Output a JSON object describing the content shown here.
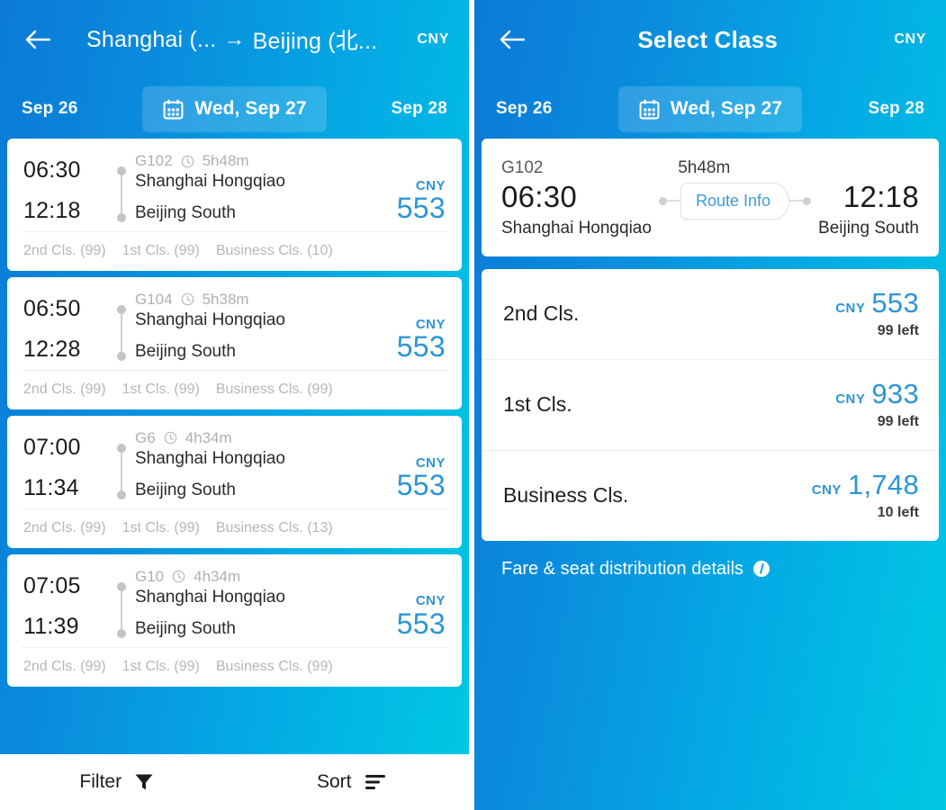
{
  "left": {
    "appbar": {
      "back_icon": "back-arrow-icon",
      "route_from": "Shanghai (...",
      "route_arrow": "→",
      "route_to": "Beijing (北...",
      "currency": "CNY"
    },
    "datestrip": {
      "prev_date": "Sep 26",
      "current_date": "Wed, Sep 27",
      "next_date": "Sep 28",
      "calendar_icon": "calendar-icon"
    },
    "trains": [
      {
        "number": "G102",
        "duration": "5h48m",
        "depart_time": "06:30",
        "arrive_time": "12:18",
        "depart_station": "Shanghai Hongqiao",
        "arrive_station": "Beijing South",
        "currency": "CNY",
        "price": "553",
        "classes": [
          "2nd Cls. (99)",
          "1st Cls. (99)",
          "Business Cls. (10)"
        ]
      },
      {
        "number": "G104",
        "duration": "5h38m",
        "depart_time": "06:50",
        "arrive_time": "12:28",
        "depart_station": "Shanghai Hongqiao",
        "arrive_station": "Beijing South",
        "currency": "CNY",
        "price": "553",
        "classes": [
          "2nd Cls. (99)",
          "1st Cls. (99)",
          "Business Cls. (99)"
        ]
      },
      {
        "number": "G6",
        "duration": "4h34m",
        "depart_time": "07:00",
        "arrive_time": "11:34",
        "depart_station": "Shanghai Hongqiao",
        "arrive_station": "Beijing South",
        "currency": "CNY",
        "price": "553",
        "classes": [
          "2nd Cls. (99)",
          "1st Cls. (99)",
          "Business Cls. (13)"
        ]
      },
      {
        "number": "G10",
        "duration": "4h34m",
        "depart_time": "07:05",
        "arrive_time": "11:39",
        "depart_station": "Shanghai Hongqiao",
        "arrive_station": "Beijing South",
        "currency": "CNY",
        "price": "553",
        "classes": [
          "2nd Cls. (99)",
          "1st Cls. (99)",
          "Business Cls. (99)"
        ]
      }
    ],
    "bottombar": {
      "filter_label": "Filter",
      "filter_icon": "funnel-icon",
      "sort_label": "Sort",
      "sort_icon": "sort-lines-icon"
    }
  },
  "right": {
    "appbar": {
      "back_icon": "back-arrow-icon",
      "title": "Select Class",
      "currency": "CNY"
    },
    "datestrip": {
      "prev_date": "Sep 26",
      "current_date": "Wed, Sep 27",
      "next_date": "Sep 28",
      "calendar_icon": "calendar-icon"
    },
    "summary": {
      "train_number": "G102",
      "duration": "5h48m",
      "depart_time": "06:30",
      "depart_station": "Shanghai Hongqiao",
      "arrive_time": "12:18",
      "arrive_station": "Beijing South",
      "route_info_label": "Route Info"
    },
    "classes": [
      {
        "name": "2nd Cls.",
        "currency": "CNY",
        "price": "553",
        "seats_left": "99 left"
      },
      {
        "name": "1st Cls.",
        "currency": "CNY",
        "price": "933",
        "seats_left": "99 left"
      },
      {
        "name": "Business Cls.",
        "currency": "CNY",
        "price": "1,748",
        "seats_left": "10 left"
      }
    ],
    "fare_link": {
      "label": "Fare & seat distribution details",
      "icon": "info-icon"
    }
  },
  "colors": {
    "gradient_start": "#0b7ad6",
    "gradient_end": "#00c9e2",
    "accent_price": "#2b95d6",
    "card_bg": "#ffffff",
    "muted_text": "#b3b3b3"
  }
}
